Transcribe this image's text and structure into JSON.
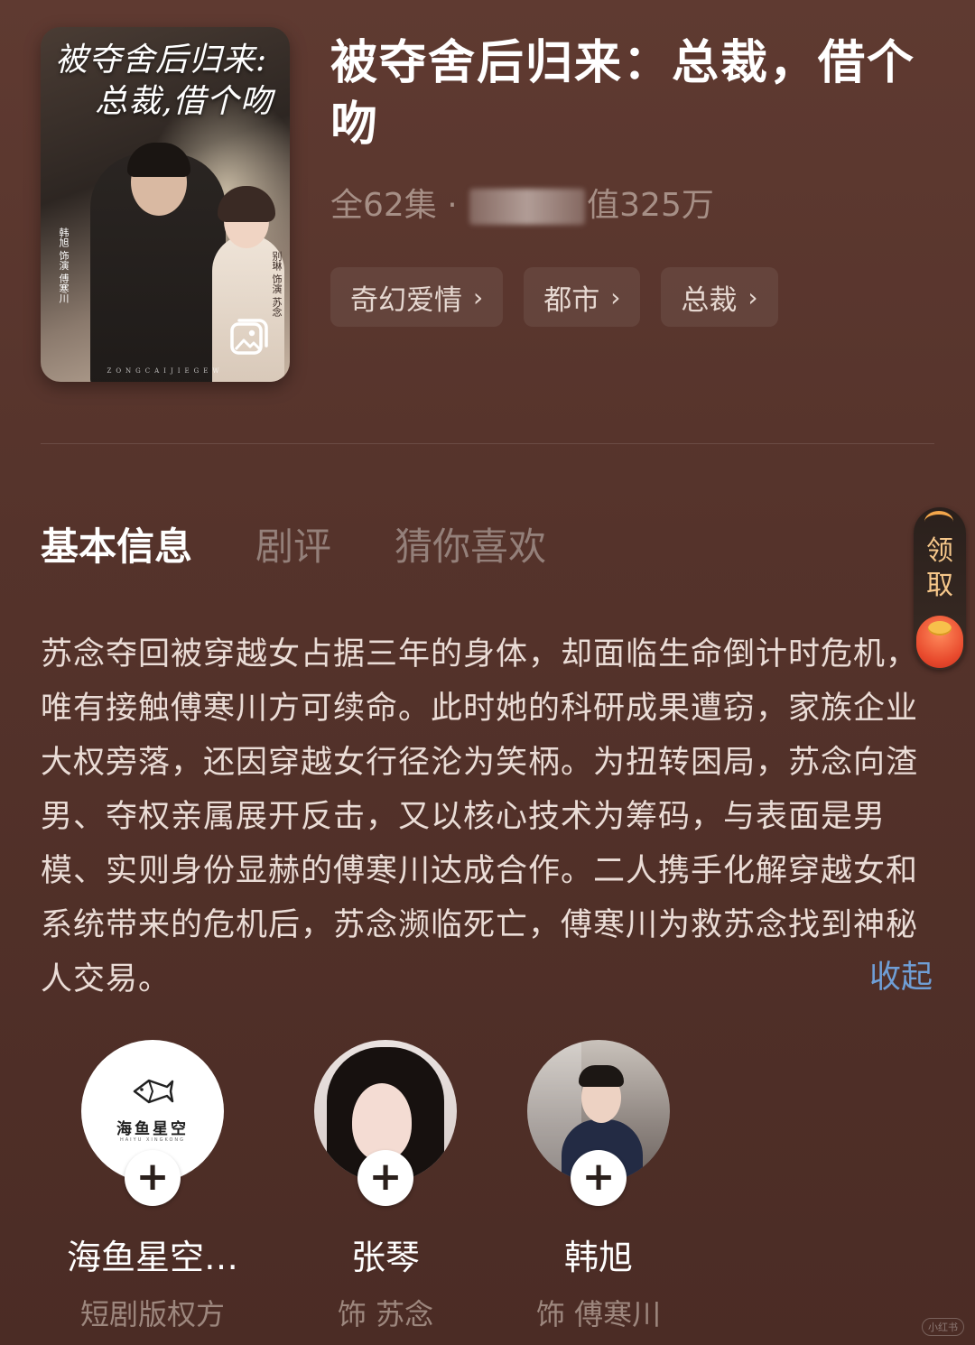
{
  "drama": {
    "cover_title_line1": "被夺舍后归来:",
    "cover_title_line2": "总裁,借个吻",
    "cover_cast_left": "韩旭 饰演 傅寒川",
    "cover_cast_right": "别琳 饰演 苏念",
    "cover_footer": "ZONGCAIJIEGEW",
    "title": "被夺舍后归来：总裁，借个吻",
    "episodes": "全62集 · ",
    "heat_suffix": "值325万"
  },
  "tags": [
    {
      "label": "奇幻爱情"
    },
    {
      "label": "都市"
    },
    {
      "label": "总裁"
    }
  ],
  "tabs": [
    {
      "label": "基本信息"
    },
    {
      "label": "剧评"
    },
    {
      "label": "猜你喜欢"
    }
  ],
  "reward": {
    "label": "领取"
  },
  "synopsis": {
    "text": "苏念夺回被穿越女占据三年的身体，却面临生命倒计时危机，唯有接触傅寒川方可续命。此时她的科研成果遭窃，家族企业大权旁落，还因穿越女行径沦为笑柄。为扭转困局，苏念向渣男、夺权亲属展开反击，又以核心技术为筹码，与表面是男模、实则身份显赫的傅寒川达成合作。二人携手化解穿越女和系统带来的危机后，苏念濒临死亡，傅寒川为救苏念找到神秘人交易。",
    "collapse_label": "收起"
  },
  "cast": [
    {
      "name": "海鱼星空…",
      "role": "短剧版权方",
      "logo_text": "海鱼星空",
      "logo_sub": "HAIYU XINGKONG"
    },
    {
      "name": "张琴",
      "role": "饰 苏念"
    },
    {
      "name": "韩旭",
      "role": "饰 傅寒川"
    }
  ],
  "watermark": "小红书"
}
